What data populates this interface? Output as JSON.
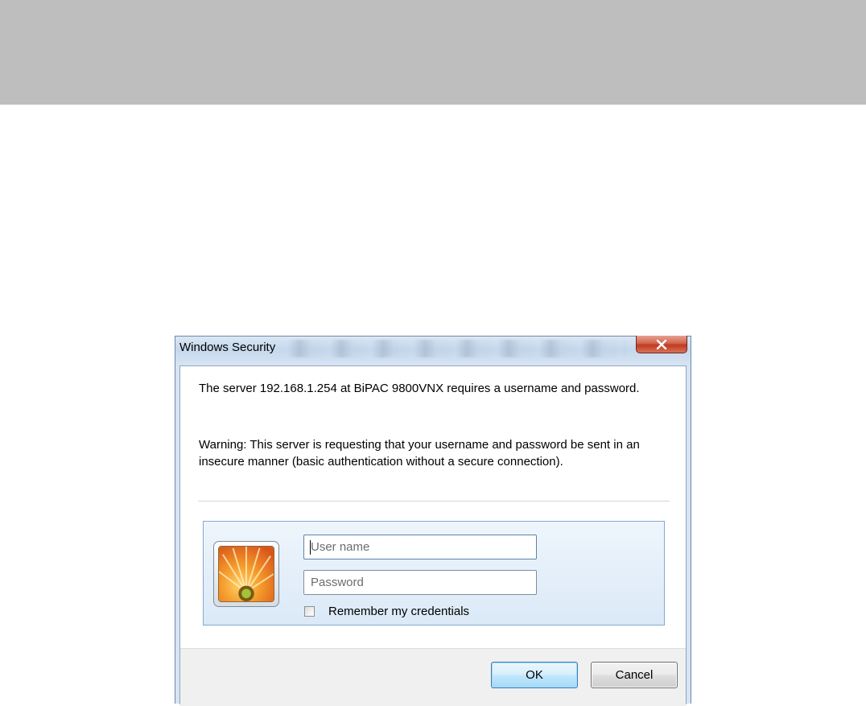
{
  "dialog": {
    "title": "Windows Security",
    "close_label": "x",
    "message": "The server 192.168.1.254 at BiPAC 9800VNX requires a username and password.",
    "warning": "Warning: This server is requesting that your username and password be sent in an insecure manner (basic authentication without a secure connection).",
    "username": {
      "value": "",
      "placeholder": "User name"
    },
    "password": {
      "value": "",
      "placeholder": "Password"
    },
    "remember": {
      "label": "Remember my credentials",
      "checked": false
    },
    "ok_label": "OK",
    "cancel_label": "Cancel"
  },
  "colors": {
    "top_band": "#bebebe",
    "dialog_frame": "#c5d8ec",
    "close_button": "#c1391f",
    "credential_panel": "#dbe9f7",
    "ok_border": "#3c7fb1"
  },
  "icons": {
    "close": "close-icon",
    "avatar": "flower-avatar-icon",
    "checkbox": "checkbox-icon"
  }
}
